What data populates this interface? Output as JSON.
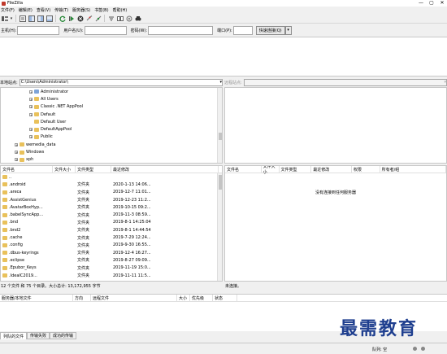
{
  "app": {
    "title": "FileZilla"
  },
  "window_controls": {
    "minimize": "—",
    "maximize": "▢",
    "close": "✕"
  },
  "menu": [
    "文件(F)",
    "编辑(E)",
    "查看(V)",
    "传输(T)",
    "服务器(S)",
    "书签(B)",
    "帮助(H)"
  ],
  "toolbar_icons": [
    "site-manager",
    "dropdown",
    "toggle-log",
    "toggle-tree-local",
    "toggle-tree-remote",
    "toggle-queue",
    "refresh",
    "process-queue",
    "cancel",
    "disconnect",
    "reconnect",
    "filter",
    "compare",
    "sync-browse",
    "search"
  ],
  "quickconnect": {
    "host_label": "主机(H):",
    "user_label": "用户名(U):",
    "pass_label": "密码(W):",
    "port_label": "端口(P):",
    "host": "",
    "user": "",
    "pass": "",
    "port": "",
    "button": "快速连接(Q)",
    "dropdown": "▾"
  },
  "local": {
    "path_label": "本地站点:",
    "path": "C:\\Users\\Administrator\\",
    "tree": [
      {
        "label": "Administrator",
        "indent": 3,
        "expander": "+",
        "kind": "user"
      },
      {
        "label": "All Users",
        "indent": 3,
        "expander": "+",
        "kind": "folder"
      },
      {
        "label": "Classic .NET AppPool",
        "indent": 3,
        "expander": "+",
        "kind": "folder"
      },
      {
        "label": "Default",
        "indent": 3,
        "expander": "+",
        "kind": "folder"
      },
      {
        "label": "Default User",
        "indent": 3,
        "expander": "",
        "kind": "folder"
      },
      {
        "label": "DefaultAppPool",
        "indent": 3,
        "expander": "+",
        "kind": "folder"
      },
      {
        "label": "Public",
        "indent": 3,
        "expander": "+",
        "kind": "folder"
      },
      {
        "label": "wemedia_data",
        "indent": 1,
        "expander": "+",
        "kind": "folder"
      },
      {
        "label": "Windows",
        "indent": 1,
        "expander": "+",
        "kind": "folder"
      },
      {
        "label": "xph",
        "indent": 1,
        "expander": "+",
        "kind": "folder"
      }
    ],
    "columns": [
      "文件名",
      "文件大小",
      "文件类型",
      "最近修改"
    ],
    "files": [
      {
        "name": "..",
        "size": "",
        "type": "",
        "modified": ""
      },
      {
        "name": ".android",
        "size": "",
        "type": "文件夹",
        "modified": "2020-1-13 14:06..."
      },
      {
        "name": ".areca",
        "size": "",
        "type": "文件夹",
        "modified": "2019-12-7 11:01..."
      },
      {
        "name": ".AssistGenius",
        "size": "",
        "type": "文件夹",
        "modified": "2019-12-23 11:2..."
      },
      {
        "name": ".AvatarBoxHyp...",
        "size": "",
        "type": "文件夹",
        "modified": "2019-10-15 09:2..."
      },
      {
        "name": ".babelSyncApp...",
        "size": "",
        "type": "文件夹",
        "modified": "2019-11-3 08:59..."
      },
      {
        "name": ".bnd",
        "size": "",
        "type": "文件夹",
        "modified": "2019-8-1 14:25:04"
      },
      {
        "name": ".bnd2",
        "size": "",
        "type": "文件夹",
        "modified": "2019-8-1 14:44:54"
      },
      {
        "name": ".cache",
        "size": "",
        "type": "文件夹",
        "modified": "2019-7-29 12:24..."
      },
      {
        "name": ".config",
        "size": "",
        "type": "文件夹",
        "modified": "2019-9-30 16:55..."
      },
      {
        "name": ".dbus-keyrings",
        "size": "",
        "type": "文件夹",
        "modified": "2019-12-4 16:27..."
      },
      {
        "name": ".eclipse",
        "size": "",
        "type": "文件夹",
        "modified": "2019-8-27 09:09..."
      },
      {
        "name": ".Epubor_Keys",
        "size": "",
        "type": "文件夹",
        "modified": "2019-11-19 15:0..."
      },
      {
        "name": ".IdeaIC2019...",
        "size": "",
        "type": "文件夹",
        "modified": "2019-11-11 11:5..."
      }
    ],
    "status": "12 个文件 和 75 个目录。大小总计: 13,172,955 字节"
  },
  "remote": {
    "path_label": "远程站点:",
    "path": "",
    "columns": [
      "文件名",
      "文件大小",
      "文件类型",
      "最近修改",
      "权限",
      "所有者/组"
    ],
    "empty_message": "没有连接到任何服务器",
    "status": "未连接。"
  },
  "queue": {
    "columns": [
      "服务器/本地文件",
      "方向",
      "远程文件",
      "大小",
      "优先级",
      "状态"
    ]
  },
  "tabs": [
    "列队的文件",
    "传输失败",
    "成功的传输"
  ],
  "statusbar": {
    "queue": "队列: 空"
  },
  "watermark": "最需教育"
}
